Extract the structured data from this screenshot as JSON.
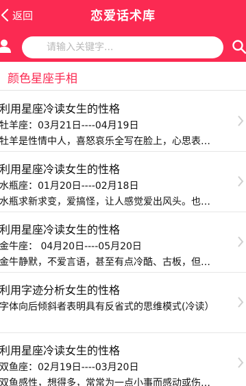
{
  "header": {
    "back_label": "返回",
    "title": "恋爱话术库",
    "accent_color": "#fb2a52"
  },
  "search": {
    "placeholder": "请输入关键字..."
  },
  "section": {
    "title": "颜色星座手相"
  },
  "icons": {
    "back": "chevron-left-icon",
    "user": "user-icon",
    "search": "search-icon",
    "item_arrow": "chevron-right-icon"
  },
  "items": [
    {
      "title": "利用星座冷读女生的性格",
      "date": "牡羊座：03月21日----04月19日",
      "desc": "牡羊是性情中人，喜怒哀乐全写在脸上，心思表…"
    },
    {
      "title": "利用星座冷读女生的性格",
      "date": "水瓶座：01月20日----02月18日",
      "desc": "水瓶求新求变，爱搞怪，让人感觉爱出风头。也…"
    },
    {
      "title": "利用星座冷读女生的性格",
      "date": "金牛座： 04月20日----05月20日",
      "desc": "金牛静默，不爱言语，甚至有点冷酷、古板，但…"
    },
    {
      "title": "利用字迹分析女生的性格",
      "date": "",
      "desc": "字体向后倾斜者表明具有反省式的思维模式(冷读）"
    },
    {
      "title": "利用星座冷读女生的性格",
      "date": "双鱼座：02月19日----03月20日",
      "desc": "双鱼感性，想得多，常常为一点小事而感动或伤…"
    }
  ]
}
